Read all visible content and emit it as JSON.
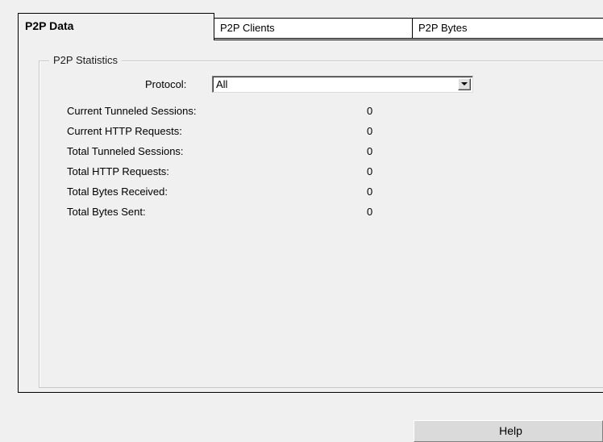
{
  "tabs": [
    {
      "label": "P2P Data",
      "active": true
    },
    {
      "label": "P2P Clients",
      "active": false
    },
    {
      "label": "P2P Bytes",
      "active": false
    }
  ],
  "group": {
    "title": "P2P Statistics"
  },
  "protocol": {
    "label": "Protocol:",
    "selected": "All"
  },
  "stats": [
    {
      "label": "Current Tunneled Sessions:",
      "value": "0"
    },
    {
      "label": "Current HTTP Requests:",
      "value": "0"
    },
    {
      "label": "Total Tunneled Sessions:",
      "value": "0"
    },
    {
      "label": "Total HTTP Requests:",
      "value": "0"
    },
    {
      "label": "Total Bytes Received:",
      "value": "0"
    },
    {
      "label": "Total Bytes Sent:",
      "value": "0"
    }
  ],
  "help_button": {
    "label": "Help"
  },
  "icons": {
    "dropdown": "chevron-down-icon"
  }
}
